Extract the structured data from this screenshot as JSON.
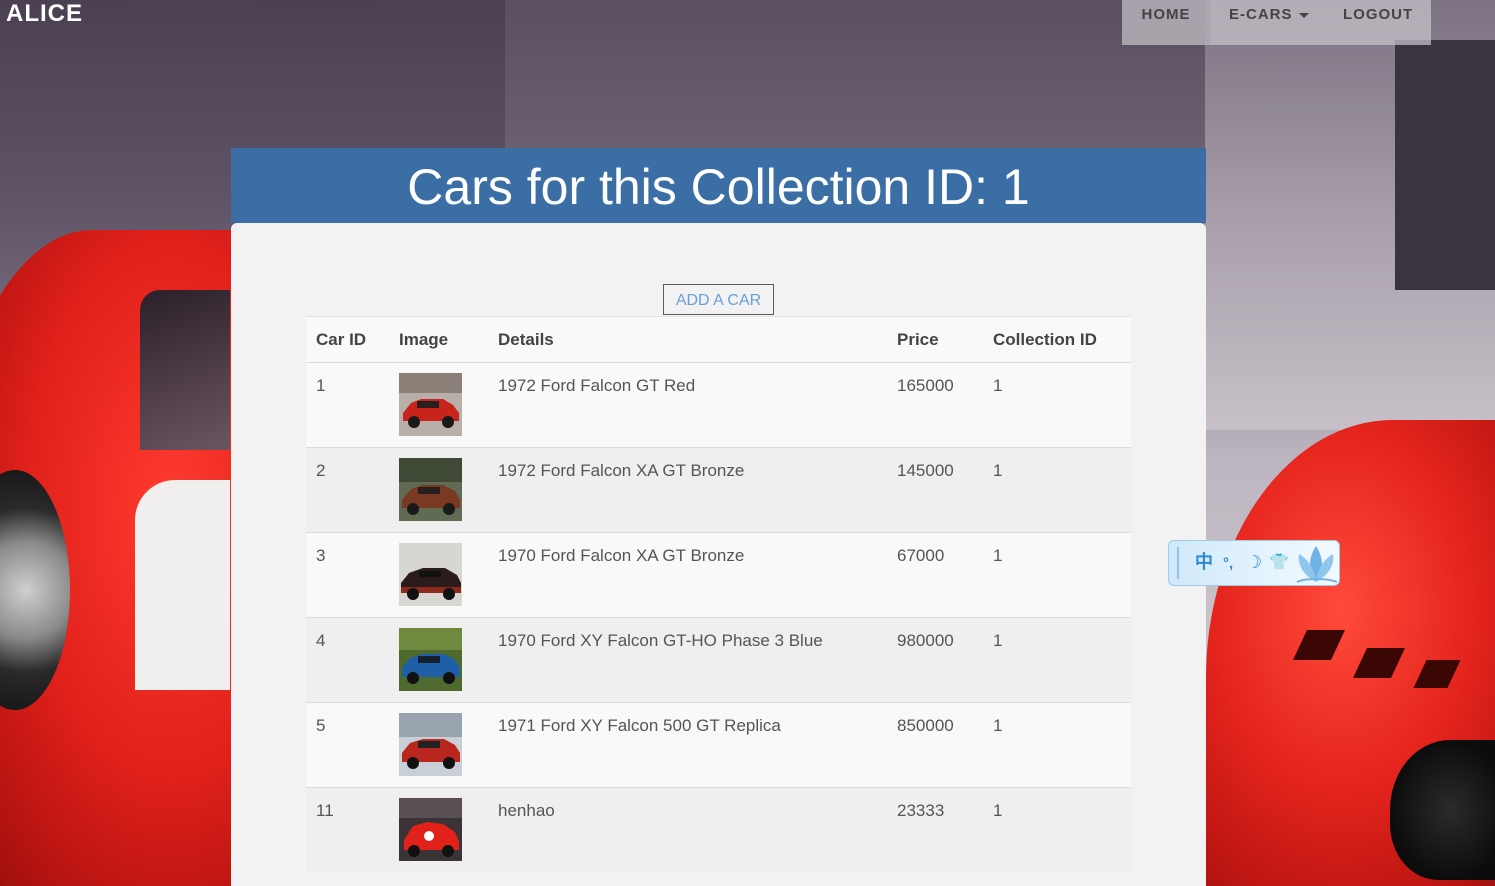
{
  "brand": {
    "name": "ALICE"
  },
  "nav": {
    "items": [
      {
        "label": "HOME"
      },
      {
        "label": "E-CARS"
      },
      {
        "label": "LOGOUT"
      }
    ]
  },
  "main": {
    "title": "Cars for this Collection ID: 1",
    "add_button": "ADD A CAR",
    "table": {
      "columns": [
        "Car ID",
        "Image",
        "Details",
        "Price",
        "Collection ID"
      ],
      "rows": [
        {
          "car_id": "1",
          "details": "1972 Ford Falcon GT Red",
          "price": "165000",
          "collection_id": "1",
          "thumb": "red-car-thumbnail"
        },
        {
          "car_id": "2",
          "details": "1972 Ford Falcon XA GT Bronze",
          "price": "145000",
          "collection_id": "1",
          "thumb": "bronze-car-thumbnail"
        },
        {
          "car_id": "3",
          "details": "1970 Ford Falcon XA GT Bronze",
          "price": "67000",
          "collection_id": "1",
          "thumb": "bronze-car-thumbnail"
        },
        {
          "car_id": "4",
          "details": "1970 Ford XY Falcon GT-HO Phase 3 Blue",
          "price": "980000",
          "collection_id": "1",
          "thumb": "blue-car-thumbnail"
        },
        {
          "car_id": "5",
          "details": "1971 Ford XY Falcon 500 GT Replica",
          "price": "850000",
          "collection_id": "1",
          "thumb": "red-car-thumbnail"
        },
        {
          "car_id": "11",
          "details": "henhao",
          "price": "23333",
          "collection_id": "1",
          "thumb": "red-race-car-thumbnail"
        }
      ]
    }
  },
  "ime_widget": {
    "items": [
      {
        "label": "中",
        "icon": "chinese-mode-icon"
      },
      {
        "label": "°,",
        "icon": "punctuation-icon"
      },
      {
        "label": "☽",
        "icon": "half-width-moon-icon"
      },
      {
        "label": "👕",
        "icon": "skin-shirt-icon"
      }
    ],
    "logo": "lotus-flower-icon"
  },
  "colors": {
    "header_blue": "#3a6ea5",
    "link_blue": "#6aa0d8",
    "panel_bg": "#f2f2f2"
  }
}
